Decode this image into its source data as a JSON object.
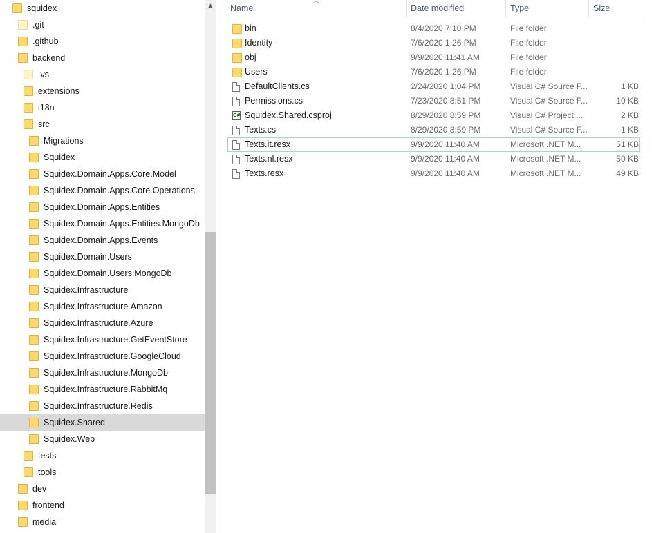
{
  "nav": {
    "items": [
      {
        "label": "squidex",
        "indent": 18,
        "icon": "folder-icon",
        "selected": false
      },
      {
        "label": ".git",
        "indent": 26,
        "icon": "folder-icon-pale",
        "selected": false
      },
      {
        "label": ".github",
        "indent": 26,
        "icon": "folder-icon",
        "selected": false
      },
      {
        "label": "backend",
        "indent": 26,
        "icon": "folder-icon",
        "selected": false
      },
      {
        "label": ".vs",
        "indent": 34,
        "icon": "folder-icon-pale",
        "selected": false
      },
      {
        "label": "extensions",
        "indent": 34,
        "icon": "folder-icon",
        "selected": false
      },
      {
        "label": "i18n",
        "indent": 34,
        "icon": "folder-icon",
        "selected": false
      },
      {
        "label": "src",
        "indent": 34,
        "icon": "folder-icon",
        "selected": false
      },
      {
        "label": "Migrations",
        "indent": 42,
        "icon": "folder-icon",
        "selected": false
      },
      {
        "label": "Squidex",
        "indent": 42,
        "icon": "folder-icon",
        "selected": false
      },
      {
        "label": "Squidex.Domain.Apps.Core.Model",
        "indent": 42,
        "icon": "folder-icon",
        "selected": false
      },
      {
        "label": "Squidex.Domain.Apps.Core.Operations",
        "indent": 42,
        "icon": "folder-icon",
        "selected": false
      },
      {
        "label": "Squidex.Domain.Apps.Entities",
        "indent": 42,
        "icon": "folder-icon",
        "selected": false
      },
      {
        "label": "Squidex.Domain.Apps.Entities.MongoDb",
        "indent": 42,
        "icon": "folder-icon",
        "selected": false
      },
      {
        "label": "Squidex.Domain.Apps.Events",
        "indent": 42,
        "icon": "folder-icon",
        "selected": false
      },
      {
        "label": "Squidex.Domain.Users",
        "indent": 42,
        "icon": "folder-icon",
        "selected": false
      },
      {
        "label": "Squidex.Domain.Users.MongoDb",
        "indent": 42,
        "icon": "folder-icon",
        "selected": false
      },
      {
        "label": "Squidex.Infrastructure",
        "indent": 42,
        "icon": "folder-icon",
        "selected": false
      },
      {
        "label": "Squidex.Infrastructure.Amazon",
        "indent": 42,
        "icon": "folder-icon",
        "selected": false
      },
      {
        "label": "Squidex.Infrastructure.Azure",
        "indent": 42,
        "icon": "folder-icon",
        "selected": false
      },
      {
        "label": "Squidex.Infrastructure.GetEventStore",
        "indent": 42,
        "icon": "folder-icon",
        "selected": false
      },
      {
        "label": "Squidex.Infrastructure.GoogleCloud",
        "indent": 42,
        "icon": "folder-icon",
        "selected": false
      },
      {
        "label": "Squidex.Infrastructure.MongoDb",
        "indent": 42,
        "icon": "folder-icon",
        "selected": false
      },
      {
        "label": "Squidex.Infrastructure.RabbitMq",
        "indent": 42,
        "icon": "folder-icon",
        "selected": false
      },
      {
        "label": "Squidex.Infrastructure.Redis",
        "indent": 42,
        "icon": "folder-icon",
        "selected": false
      },
      {
        "label": "Squidex.Shared",
        "indent": 42,
        "icon": "folder-icon",
        "selected": true
      },
      {
        "label": "Squidex.Web",
        "indent": 42,
        "icon": "folder-icon",
        "selected": false
      },
      {
        "label": "tests",
        "indent": 34,
        "icon": "folder-icon",
        "selected": false
      },
      {
        "label": "tools",
        "indent": 34,
        "icon": "folder-icon",
        "selected": false
      },
      {
        "label": "dev",
        "indent": 26,
        "icon": "folder-icon",
        "selected": false
      },
      {
        "label": "frontend",
        "indent": 26,
        "icon": "folder-icon",
        "selected": false
      },
      {
        "label": "media",
        "indent": 26,
        "icon": "folder-icon",
        "selected": false
      }
    ]
  },
  "list": {
    "columns": {
      "name": "Name",
      "date": "Date modified",
      "type": "Type",
      "size": "Size"
    },
    "sort_glyph": "︿",
    "rows": [
      {
        "name": "bin",
        "date": "8/4/2020 7:10 PM",
        "type": "File folder",
        "size": "",
        "icon": "folder-icon",
        "focused": false
      },
      {
        "name": "Identity",
        "date": "7/6/2020 1:26 PM",
        "type": "File folder",
        "size": "",
        "icon": "folder-icon",
        "focused": false
      },
      {
        "name": "obj",
        "date": "9/9/2020 11:41 AM",
        "type": "File folder",
        "size": "",
        "icon": "folder-icon",
        "focused": false
      },
      {
        "name": "Users",
        "date": "7/6/2020 1:26 PM",
        "type": "File folder",
        "size": "",
        "icon": "folder-icon",
        "focused": false
      },
      {
        "name": "DefaultClients.cs",
        "date": "2/24/2020 1:04 PM",
        "type": "Visual C# Source F...",
        "size": "1 KB",
        "icon": "document-icon",
        "focused": false
      },
      {
        "name": "Permissions.cs",
        "date": "7/23/2020 8:51 PM",
        "type": "Visual C# Source F...",
        "size": "10 KB",
        "icon": "document-icon",
        "focused": false
      },
      {
        "name": "Squidex.Shared.csproj",
        "date": "8/29/2020 8:59 PM",
        "type": "Visual C# Project ...",
        "size": "2 KB",
        "icon": "csharp-project-icon",
        "focused": false
      },
      {
        "name": "Texts.cs",
        "date": "8/29/2020 8:59 PM",
        "type": "Visual C# Source F...",
        "size": "1 KB",
        "icon": "document-icon",
        "focused": false
      },
      {
        "name": "Texts.it.resx",
        "date": "9/9/2020 11:40 AM",
        "type": "Microsoft .NET M...",
        "size": "51 KB",
        "icon": "document-icon",
        "focused": true
      },
      {
        "name": "Texts.nl.resx",
        "date": "9/9/2020 11:40 AM",
        "type": "Microsoft .NET M...",
        "size": "50 KB",
        "icon": "document-icon",
        "focused": false
      },
      {
        "name": "Texts.resx",
        "date": "9/9/2020 11:40 AM",
        "type": "Microsoft .NET M...",
        "size": "49 KB",
        "icon": "document-icon",
        "focused": false
      }
    ]
  },
  "scrollbar": {
    "up_glyph": "▲"
  },
  "colors": {
    "folder": "#ffd86b",
    "selection": "#d9d9d9",
    "focus_border": "#99d1ff",
    "header_text": "#4c607a"
  }
}
